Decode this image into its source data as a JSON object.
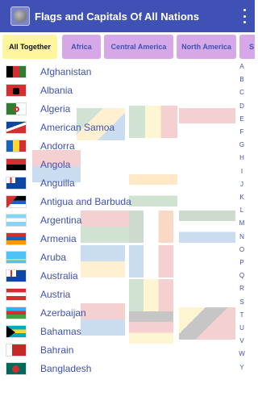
{
  "appbar": {
    "title": "Flags and Capitals Of All Nations",
    "icon": "globe-icon",
    "menu_icon": "overflow-menu-icon",
    "color": "#3f51b5"
  },
  "tabs": [
    {
      "label": "All Together",
      "active": true
    },
    {
      "label": "Africa",
      "active": false
    },
    {
      "label": "Central America",
      "active": false
    },
    {
      "label": "North America",
      "active": false
    },
    {
      "label": "S",
      "active": false
    }
  ],
  "countries": [
    {
      "name": "Afghanistan",
      "flag": "afghanistan-flag-icon"
    },
    {
      "name": "Albania",
      "flag": "albania-flag-icon"
    },
    {
      "name": "Algeria",
      "flag": "algeria-flag-icon"
    },
    {
      "name": "American Samoa",
      "flag": "american-samoa-flag-icon"
    },
    {
      "name": "Andorra",
      "flag": "andorra-flag-icon"
    },
    {
      "name": "Angola",
      "flag": "angola-flag-icon"
    },
    {
      "name": "Anguilla",
      "flag": "anguilla-flag-icon"
    },
    {
      "name": "Antigua and Barbuda",
      "flag": "antigua-flag-icon"
    },
    {
      "name": "Argentina",
      "flag": "argentina-flag-icon"
    },
    {
      "name": "Armenia",
      "flag": "armenia-flag-icon"
    },
    {
      "name": "Aruba",
      "flag": "aruba-flag-icon"
    },
    {
      "name": "Australia",
      "flag": "australia-flag-icon"
    },
    {
      "name": "Austria",
      "flag": "austria-flag-icon"
    },
    {
      "name": "Azerbaijan",
      "flag": "azerbaijan-flag-icon"
    },
    {
      "name": "Bahamas",
      "flag": "bahamas-flag-icon"
    },
    {
      "name": "Bahrain",
      "flag": "bahrain-flag-icon"
    },
    {
      "name": "Bangladesh",
      "flag": "bangladesh-flag-icon"
    }
  ],
  "alphabet": [
    "A",
    "B",
    "C",
    "D",
    "E",
    "F",
    "G",
    "H",
    "I",
    "J",
    "K",
    "L",
    "M",
    "N",
    "O",
    "P",
    "Q",
    "R",
    "S",
    "T",
    "U",
    "V",
    "W",
    "Y"
  ],
  "colors": {
    "tab_inactive": "#d7a8e8",
    "tab_active": "#fff59d",
    "link_text": "#3f51b5"
  }
}
